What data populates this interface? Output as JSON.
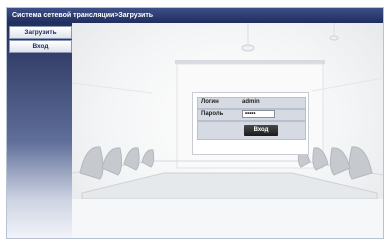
{
  "window": {
    "title": "Система сетевой трансляции>Загрузить"
  },
  "sidebar": {
    "items": [
      {
        "label": "Загрузить"
      },
      {
        "label": "Вход"
      }
    ]
  },
  "login": {
    "username_label": "Логин",
    "username_value": "admin",
    "password_label": "Пароль",
    "password_value": "•••••",
    "submit_label": "Вход"
  },
  "colors": {
    "titlebar": "#1f2d5e",
    "sidebar_top": "#242f57",
    "panel_row": "#d6dae2",
    "button": "#1a1a1a"
  }
}
